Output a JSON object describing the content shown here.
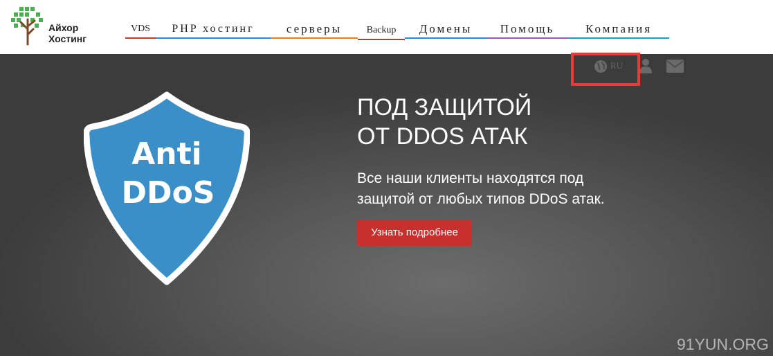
{
  "logo": {
    "line1": "Айхор",
    "line2": "Хостинг"
  },
  "nav": {
    "items": [
      {
        "label": "VDS",
        "color": "#c0392b"
      },
      {
        "label": "PHP хостинг",
        "color": "#2e86de"
      },
      {
        "label": "серверы",
        "color": "#e67e22"
      },
      {
        "label": "Backup",
        "color": "#c0392b"
      },
      {
        "label": "Домены",
        "color": "#2e86de"
      },
      {
        "label": "Помощь",
        "color": "#9b59b6"
      },
      {
        "label": "Компания",
        "color": "#17a2b8"
      }
    ]
  },
  "utility": {
    "lang": "RU",
    "icons": [
      "globe-icon",
      "user-icon",
      "mail-icon"
    ]
  },
  "hero": {
    "shield_line1": "Anti",
    "shield_line2": "DDoS",
    "headline_line1": "ПОД ЗАЩИТОЙ",
    "headline_line2": "ОТ DDOS АТАК",
    "sub_line1": "Все наши клиенты находятся под",
    "sub_line2": "защитой от любых типов DDoS атак.",
    "cta": "Узнать подробнее"
  },
  "watermark": "91YUN.ORG",
  "colors": {
    "shield": "#3a8fc9",
    "cta": "#c7302d",
    "highlight": "#ec3b37",
    "logo_green": "#4caf50"
  }
}
